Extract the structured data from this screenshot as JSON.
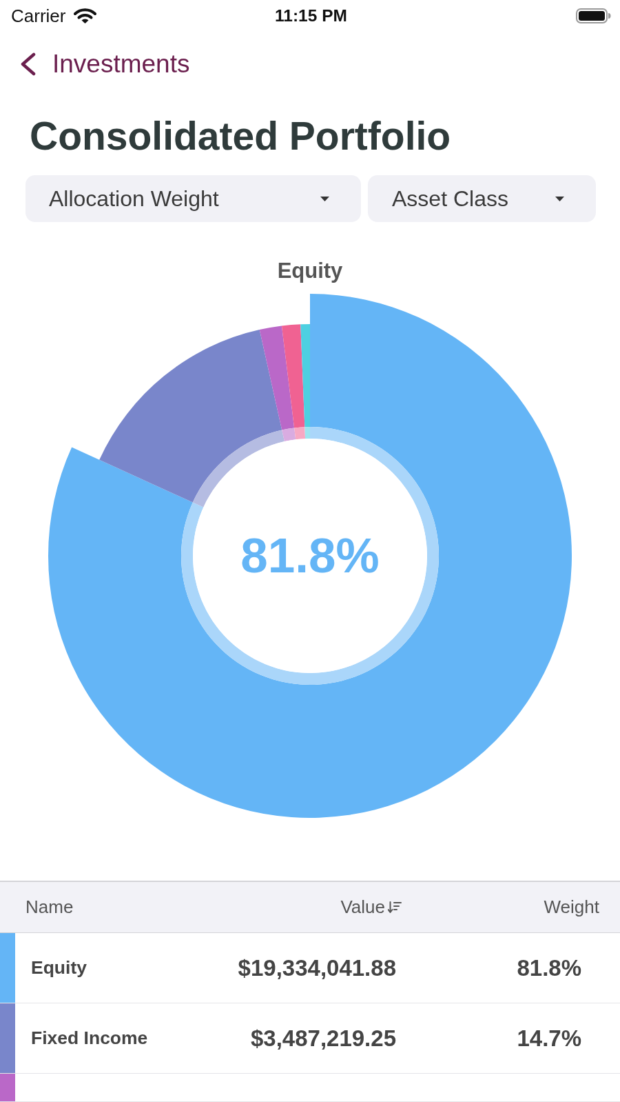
{
  "status_bar": {
    "carrier": "Carrier",
    "time": "11:15 PM"
  },
  "nav": {
    "back_label": "Investments"
  },
  "title": "Consolidated Portfolio",
  "pickers": [
    {
      "label": "Allocation Weight"
    },
    {
      "label": "Asset Class"
    }
  ],
  "chart": {
    "title": "Equity",
    "center_label": "81.8%",
    "slices": [
      {
        "color": "#64b5f6",
        "selected": true
      },
      {
        "color": "#7986cb",
        "selected": false
      },
      {
        "color": "#ba68c8",
        "selected": false
      },
      {
        "color": "#f06292",
        "selected": false
      },
      {
        "color": "#4dd0e1",
        "selected": false
      }
    ]
  },
  "table": {
    "columns": [
      {
        "label": "Name",
        "sorted": false
      },
      {
        "label": "Value",
        "sorted": true
      },
      {
        "label": "Weight",
        "sorted": false
      }
    ],
    "rows": [
      {
        "color": "#64b5f6",
        "name": "Equity",
        "value": "$19,334,041.88",
        "weight": "81.8%"
      },
      {
        "color": "#7986cb",
        "name": "Fixed Income",
        "value": "$3,487,219.25",
        "weight": "14.7%"
      },
      {
        "color": "#ba68c8"
      }
    ]
  }
}
